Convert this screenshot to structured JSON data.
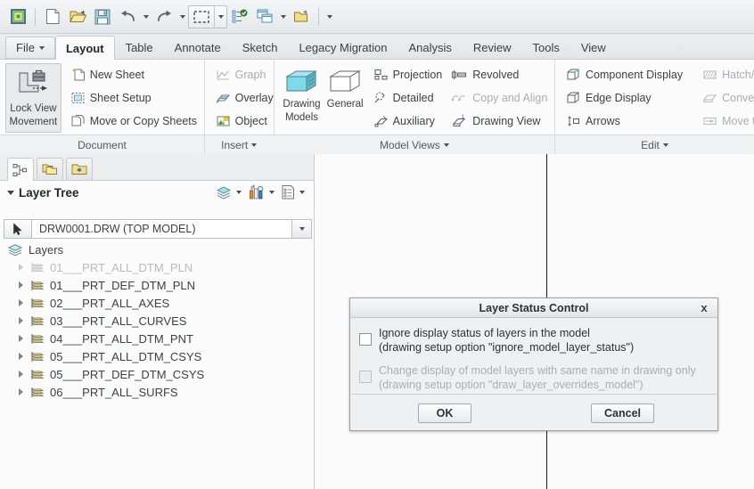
{
  "quick_access": {
    "buttons": [
      {
        "name": "app-logo-icon",
        "label": "Creo"
      },
      {
        "name": "new-icon",
        "label": "New"
      },
      {
        "name": "open-icon",
        "label": "Open"
      },
      {
        "name": "save-icon",
        "label": "Save"
      },
      {
        "name": "undo-icon",
        "label": "Undo"
      },
      {
        "name": "redo-icon",
        "label": "Redo"
      },
      {
        "name": "selection-box-icon",
        "label": "Select Items"
      },
      {
        "name": "regenerate-icon",
        "label": "Regenerate"
      },
      {
        "name": "window-icon",
        "label": "Window"
      },
      {
        "name": "close-window-icon",
        "label": "Close"
      },
      {
        "name": "overflow-icon",
        "label": "Customize Quick Access Toolbar"
      }
    ]
  },
  "tabs": {
    "file_label": "File",
    "items": [
      {
        "label": "Layout",
        "active": true
      },
      {
        "label": "Table",
        "active": false
      },
      {
        "label": "Annotate",
        "active": false
      },
      {
        "label": "Sketch",
        "active": false
      },
      {
        "label": "Legacy Migration",
        "active": false
      },
      {
        "label": "Analysis",
        "active": false
      },
      {
        "label": "Review",
        "active": false
      },
      {
        "label": "Tools",
        "active": false
      },
      {
        "label": "View",
        "active": false
      }
    ]
  },
  "ribbon": {
    "groups": [
      {
        "title": "Document",
        "has_dropdown": false,
        "big_button": {
          "label_line1": "Lock View",
          "label_line2": "Movement",
          "icon": "lock-view-movement-icon",
          "pressed": true
        },
        "items": [
          {
            "label": "New Sheet",
            "icon": "new-sheet-icon",
            "disabled": false
          },
          {
            "label": "Sheet Setup",
            "icon": "sheet-setup-icon",
            "disabled": false
          },
          {
            "label": "Move or Copy Sheets",
            "icon": "move-copy-sheets-icon",
            "disabled": false
          }
        ]
      },
      {
        "title": "Insert",
        "has_dropdown": true,
        "items": [
          {
            "label": "Graph",
            "icon": "graph-icon",
            "disabled": true
          },
          {
            "label": "Overlay",
            "icon": "overlay-icon",
            "disabled": false
          },
          {
            "label": "Object",
            "icon": "object-icon",
            "disabled": false
          }
        ]
      },
      {
        "title": "Model Views",
        "has_dropdown": true,
        "big_buttons": [
          {
            "label_line1": "Drawing",
            "label_line2": "Models",
            "icon": "drawing-models-icon"
          },
          {
            "label_line1": "General",
            "label_line2": "",
            "icon": "general-view-icon"
          }
        ],
        "items_col1": [
          {
            "label": "Projection",
            "icon": "projection-view-icon",
            "disabled": false
          },
          {
            "label": "Detailed",
            "icon": "detailed-view-icon",
            "disabled": false
          },
          {
            "label": "Auxiliary",
            "icon": "auxiliary-view-icon",
            "disabled": false
          }
        ],
        "items_col2": [
          {
            "label": "Revolved",
            "icon": "revolved-view-icon",
            "disabled": false
          },
          {
            "label": "Copy and Align",
            "icon": "copy-align-icon",
            "disabled": true
          },
          {
            "label": "Drawing View",
            "icon": "drawing-view-icon",
            "disabled": false
          }
        ]
      },
      {
        "title": "Edit",
        "has_dropdown": true,
        "items_col1": [
          {
            "label": "Component Display",
            "icon": "component-display-icon",
            "disabled": false
          },
          {
            "label": "Edge Display",
            "icon": "edge-display-icon",
            "disabled": false
          },
          {
            "label": "Arrows",
            "icon": "arrows-icon",
            "disabled": false
          }
        ],
        "items_col2": [
          {
            "label": "Hatch/Fi",
            "icon": "hatch-fill-icon",
            "disabled": true
          },
          {
            "label": "Convert t",
            "icon": "convert-to-icon",
            "disabled": true
          },
          {
            "label": "Move to",
            "icon": "move-to-icon",
            "disabled": true
          }
        ]
      }
    ]
  },
  "navigator": {
    "tabs": [
      {
        "name": "model-tree-tab",
        "icon": "model-tree-icon",
        "active": true
      },
      {
        "name": "detail-tree-tab",
        "icon": "folder-browser-icon",
        "active": false
      },
      {
        "name": "favorites-tab",
        "icon": "favorites-folder-icon",
        "active": false
      }
    ],
    "header": {
      "title": "Layer Tree",
      "toolbar": [
        {
          "name": "layers-display-button",
          "icon": "layers-icon"
        },
        {
          "name": "layers-display-dropdown",
          "icon": "chevron-down-icon"
        },
        {
          "name": "tools-button",
          "icon": "tools-icon"
        },
        {
          "name": "tools-dropdown",
          "icon": "chevron-down-icon"
        },
        {
          "name": "tree-columns-button",
          "icon": "tree-columns-icon"
        },
        {
          "name": "tree-columns-dropdown",
          "icon": "chevron-down-icon"
        }
      ]
    },
    "filter": {
      "select_icon": "arrow-cursor-icon",
      "value": "DRW0001.DRW (TOP MODEL)",
      "dropdown_icon": "chevron-down-icon"
    },
    "tree": {
      "root": {
        "label": "Layers",
        "icon": "layers-icon"
      },
      "items": [
        {
          "label": "01___PRT_ALL_DTM_PLN",
          "disabled": true
        },
        {
          "label": "01___PRT_DEF_DTM_PLN",
          "disabled": false
        },
        {
          "label": "02___PRT_ALL_AXES",
          "disabled": false
        },
        {
          "label": "03___PRT_ALL_CURVES",
          "disabled": false
        },
        {
          "label": "04___PRT_ALL_DTM_PNT",
          "disabled": false
        },
        {
          "label": "05___PRT_ALL_DTM_CSYS",
          "disabled": false
        },
        {
          "label": "05___PRT_DEF_DTM_CSYS",
          "disabled": false
        },
        {
          "label": "06___PRT_ALL_SURFS",
          "disabled": false
        }
      ]
    }
  },
  "dialog": {
    "title": "Layer Status Control",
    "close_label": "x",
    "options": [
      {
        "checked": false,
        "disabled": false,
        "line1": "Ignore display status of layers in the model",
        "line2": "(drawing setup option \"ignore_model_layer_status\")"
      },
      {
        "checked": false,
        "disabled": true,
        "line1": "Change display of model layers with same name in drawing only",
        "line2": "(drawing setup option \"draw_layer_overrides_model\")"
      }
    ],
    "ok_label": "OK",
    "cancel_label": "Cancel"
  },
  "colors": {
    "accent_cyan": "#7fd9e8",
    "accent_yellow": "#f2d55c",
    "canvas": "#fbfbfb",
    "chrome": "#eceeef",
    "disabled_text": "#a8aeb3"
  }
}
